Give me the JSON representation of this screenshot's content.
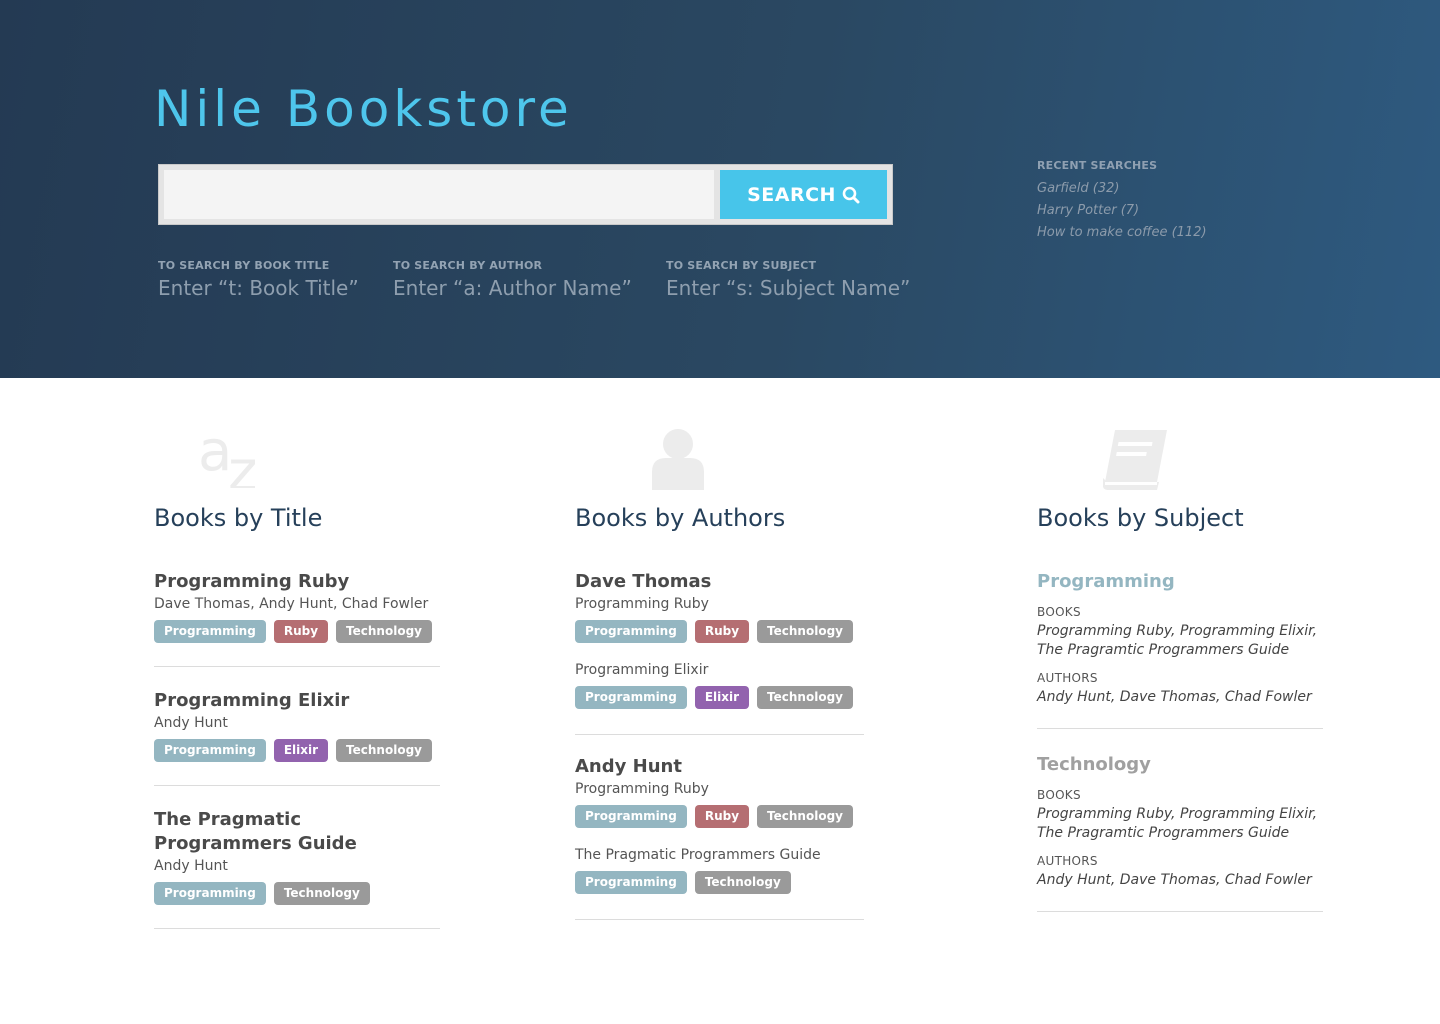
{
  "site": {
    "title": "Nile Bookstore"
  },
  "search": {
    "placeholder": "",
    "button_label": "SEARCH"
  },
  "hints": [
    {
      "label": "TO SEARCH BY BOOK TITLE",
      "example": "Enter “t: Book Title”"
    },
    {
      "label": "TO SEARCH BY AUTHOR",
      "example": "Enter “a: Author Name”"
    },
    {
      "label": "TO SEARCH BY SUBJECT",
      "example": "Enter “s: Subject Name”"
    }
  ],
  "recent": {
    "title": "RECENT SEARCHES",
    "items": [
      "Garfield (32)",
      "Harry Potter (7)",
      "How to make coffee (112)"
    ]
  },
  "tag_colors": {
    "Programming": "#94b6c1",
    "Ruby": "#b56e72",
    "Elixir": "#9263ae",
    "Technology": "#9a9a9a"
  },
  "titles": {
    "icon": "az-icon",
    "heading": "Books by Title",
    "books": [
      {
        "title": "Programming Ruby",
        "authors": "Dave Thomas, Andy Hunt, Chad Fowler",
        "tags": [
          "Programming",
          "Ruby",
          "Technology"
        ]
      },
      {
        "title": "Programming Elixir",
        "authors": "Andy Hunt",
        "tags": [
          "Programming",
          "Elixir",
          "Technology"
        ]
      },
      {
        "title": "The Pragmatic Programmers Guide",
        "authors": "Andy Hunt",
        "tags": [
          "Programming",
          "Technology"
        ]
      }
    ]
  },
  "authors": {
    "icon": "person-icon",
    "heading": "Books by Authors",
    "list": [
      {
        "name": "Dave Thomas",
        "books": [
          {
            "title": "Programming Ruby",
            "tags": [
              "Programming",
              "Ruby",
              "Technology"
            ]
          },
          {
            "title": "Programming Elixir",
            "tags": [
              "Programming",
              "Elixir",
              "Technology"
            ]
          }
        ]
      },
      {
        "name": "Andy Hunt",
        "books": [
          {
            "title": "Programming Ruby",
            "tags": [
              "Programming",
              "Ruby",
              "Technology"
            ]
          },
          {
            "title": "The Pragmatic Programmers Guide",
            "tags": [
              "Programming",
              "Technology"
            ]
          }
        ]
      }
    ]
  },
  "subjects": {
    "icon": "book-icon",
    "heading": "Books by Subject",
    "list": [
      {
        "name": "Programming",
        "color": "#94b6c1",
        "books_label": "BOOKS",
        "books": "Programming Ruby, Programming Elixir, The Pragramtic Programmers Guide",
        "authors_label": "AUTHORS",
        "authors": "Andy Hunt, Dave Thomas, Chad Fowler"
      },
      {
        "name": "Technology",
        "color": "#a0a0a0",
        "books_label": "BOOKS",
        "books": "Programming Ruby, Programming Elixir, The Pragramtic Programmers Guide",
        "authors_label": "AUTHORS",
        "authors": "Andy Hunt, Dave Thomas, Chad Fowler"
      }
    ]
  }
}
